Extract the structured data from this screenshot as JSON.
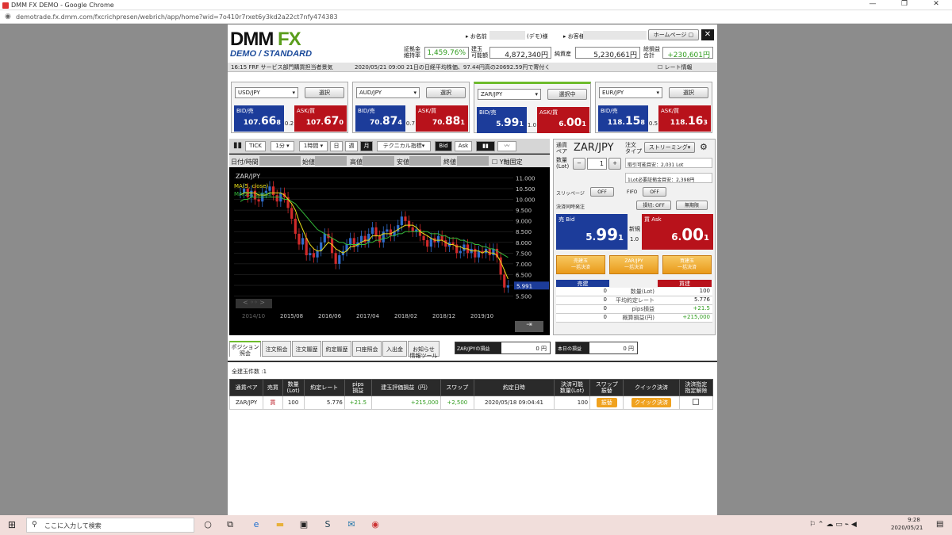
{
  "window": {
    "title": "DMM FX DEMO - Google Chrome",
    "url": "demotrade.fx.dmm.com/fxcrichpresen/webrich/app/home?wid=7o410r7rxet6y3kd2a22ct7nfy474383"
  },
  "brand": {
    "logo_main": "DMM",
    "logo_fx": "FX",
    "logo_sub": "DEMO / STANDARD"
  },
  "header": {
    "name_label": "お名前",
    "name_suffix": "(デモ)様",
    "customer_label": "お客様番号",
    "homepage_button": "ホームページ",
    "close_glyph": "✕",
    "margin_rate_label": "証拠金\n維持率",
    "margin_rate": "1,459.76%",
    "position_capacity_label": "建玉\n可能額",
    "position_capacity": "4,872,340円",
    "net_assets_label": "純資産",
    "net_assets": "5,230,661円",
    "total_pl_label": "総損益\n合計",
    "total_pl": "+230,601円"
  },
  "ticker": {
    "news1": "16:15  FRF サービス部門購買担当者景気",
    "news2": "2020/05/21 09:00 21日の日経平均株価、97.44円高の20692.59円で寄付く",
    "rate_info": "レート情報"
  },
  "quotes": [
    {
      "pair": "USD/JPY",
      "button": "選択",
      "bid_label": "BID/売",
      "ask_label": "ASK/買",
      "bid_small": "107.",
      "bid_big": "66",
      "bid_pip": "8",
      "ask_small": "107.",
      "ask_big": "67",
      "ask_pip": "0",
      "spread": "0.2"
    },
    {
      "pair": "AUD/JPY",
      "button": "選択",
      "bid_label": "BID/売",
      "ask_label": "ASK/買",
      "bid_small": "70.",
      "bid_big": "87",
      "bid_pip": "4",
      "ask_small": "70.",
      "ask_big": "88",
      "ask_pip": "1",
      "spread": "0.7"
    },
    {
      "pair": "ZAR/JPY",
      "button": "選択中",
      "bid_label": "BID/売",
      "ask_label": "ASK/買",
      "bid_small": "5.",
      "bid_big": "99",
      "bid_pip": "1",
      "ask_small": "6.",
      "ask_big": "00",
      "ask_pip": "1",
      "spread": "1.0"
    },
    {
      "pair": "EUR/JPY",
      "button": "選択",
      "bid_label": "BID/売",
      "ask_label": "ASK/買",
      "bid_small": "118.",
      "bid_big": "15",
      "bid_pip": "8",
      "ask_small": "118.",
      "ask_big": "16",
      "ask_pip": "3",
      "spread": "0.5"
    }
  ],
  "chart_toolbar": {
    "tick": "TICK",
    "min1": "1分",
    "hour1": "1時間",
    "day": "日",
    "week": "週",
    "month": "月",
    "tech": "テクニカル指標",
    "bid": "Bid",
    "ask": "Ask"
  },
  "chart_fields": {
    "datetime": "日付/時間",
    "open": "始値",
    "high": "高値",
    "low": "安値",
    "close": "終値",
    "y_fixed": "Y軸固定"
  },
  "chart_data": {
    "type": "candlestick",
    "title": "ZAR/JPY",
    "legend": [
      "MA(5, close)",
      "MA(25, close)"
    ],
    "x_ticks": [
      "2014/10",
      "2015/08",
      "2016/06",
      "2017/04",
      "2018/02",
      "2018/12",
      "2019/10"
    ],
    "y_ticks": [
      11.0,
      10.5,
      10.0,
      9.5,
      9.0,
      8.5,
      8.0,
      7.5,
      7.0,
      6.5,
      6.0,
      5.5
    ],
    "ylim": [
      5.3,
      11.2
    ],
    "current_price": "5.991",
    "close": [
      10.3,
      10.5,
      10.1,
      10.4,
      10.0,
      9.9,
      10.3,
      10.4,
      10.6,
      10.2,
      9.9,
      10.3,
      10.1,
      9.6,
      9.1,
      8.4,
      7.9,
      8.2,
      7.4,
      7.5,
      7.3,
      7.6,
      8.0,
      8.4,
      8.2,
      7.5,
      7.0,
      7.4,
      7.6,
      7.9,
      8.2,
      7.8,
      8.0,
      8.3,
      8.0,
      8.4,
      8.7,
      8.3,
      8.0,
      8.5,
      8.6,
      8.3,
      8.5,
      8.8,
      9.2,
      9.0,
      8.7,
      8.5,
      8.6,
      8.3,
      8.1,
      7.8,
      8.2,
      8.0,
      8.3,
      8.1,
      7.8,
      8.0,
      7.9,
      7.5,
      7.6,
      7.9,
      7.5,
      7.7,
      7.3,
      7.6,
      7.5,
      7.7,
      7.4,
      7.7,
      7.3,
      6.5,
      5.9,
      6.0
    ],
    "ma5": [
      10.2,
      10.3,
      10.3,
      10.3,
      10.3,
      10.2,
      10.2,
      10.2,
      10.3,
      10.3,
      10.3,
      10.3,
      10.2,
      10.0,
      9.8,
      9.5,
      9.0,
      8.6,
      8.2,
      7.9,
      7.7,
      7.6,
      7.6,
      7.8,
      8.0,
      7.9,
      7.7,
      7.6,
      7.5,
      7.6,
      7.8,
      7.8,
      7.9,
      8.0,
      8.1,
      8.1,
      8.3,
      8.3,
      8.3,
      8.4,
      8.4,
      8.4,
      8.5,
      8.6,
      8.7,
      8.8,
      8.8,
      8.8,
      8.7,
      8.5,
      8.4,
      8.3,
      8.2,
      8.1,
      8.1,
      8.1,
      8.0,
      7.9,
      7.9,
      7.8,
      7.8,
      7.7,
      7.7,
      7.6,
      7.6,
      7.6,
      7.5,
      7.6,
      7.5,
      7.5,
      7.4,
      7.1,
      6.7,
      6.3
    ],
    "ma25": [
      9.9,
      10.0,
      10.0,
      10.1,
      10.1,
      10.1,
      10.1,
      10.1,
      10.1,
      10.1,
      10.1,
      10.1,
      10.0,
      10.0,
      9.9,
      9.8,
      9.6,
      9.4,
      9.2,
      9.0,
      8.8,
      8.6,
      8.5,
      8.4,
      8.3,
      8.2,
      8.1,
      8.0,
      8.0,
      7.9,
      7.9,
      7.9,
      7.9,
      7.9,
      7.9,
      8.0,
      8.0,
      8.1,
      8.1,
      8.2,
      8.2,
      8.3,
      8.3,
      8.4,
      8.4,
      8.5,
      8.5,
      8.5,
      8.5,
      8.5,
      8.5,
      8.5,
      8.4,
      8.4,
      8.4,
      8.3,
      8.3,
      8.2,
      8.2,
      8.2,
      8.1,
      8.1,
      8.0,
      8.0,
      7.9,
      7.9,
      7.8,
      7.8,
      7.7,
      7.7,
      7.6,
      7.5,
      7.4,
      7.3
    ]
  },
  "order": {
    "pair_label": "通貨\nペア",
    "pair": "ZAR/JPY",
    "type_label": "注文\nタイプ",
    "type": "ストリーミング",
    "qty_label": "数量\n(Lot)",
    "qty": "1",
    "minus": "−",
    "plus": "+",
    "max_lot": "取引可能目安：2,031 Lot",
    "margin_req": "1Lot必要証拠金目安：2,398円",
    "slippage_label": "スリッページ",
    "slippage": "OFF",
    "fifo_label": "FIFO",
    "fifo": "OFF",
    "settle_label": "決済同時発注",
    "stoploss": "損切: OFF",
    "unlimited": "無期限",
    "bid_label": "売 Bid",
    "bid_small": "5.",
    "bid_big": "99",
    "bid_pip": "1",
    "new_label": "新規",
    "spread": "1.0",
    "ask_label": "買 Ask",
    "ask_small": "6.",
    "ask_big": "00",
    "ask_pip": "1",
    "sell_all": "売建玉\n一括決済",
    "pair_all": "ZAR/JPY\n一括決済",
    "buy_all": "買建玉\n一括決済",
    "sell_head": "売建",
    "buy_head": "買建",
    "rows": [
      {
        "s": "0",
        "k": "数量(Lot)",
        "b": "100"
      },
      {
        "s": "0",
        "k": "平均約定レート",
        "b": "5.776"
      },
      {
        "s": "0",
        "k": "pips損益",
        "b": "+21.5"
      },
      {
        "s": "0",
        "k": "概算損益(円)",
        "b": "+215,000"
      }
    ]
  },
  "tabs": [
    "ポジション\n照会",
    "注文照会",
    "注文履歴",
    "約定履歴",
    "口座照会",
    "入出金",
    "お知らせ\n情報ツール"
  ],
  "pl_boxes": {
    "pair_pl_label": "ZAR/JPYの損益",
    "pair_pl": "0 円",
    "today_pl_label": "本日の損益",
    "today_pl": "0 円"
  },
  "positions": {
    "count_label": "全建玉件数 :1",
    "headers": [
      "通貨ペア",
      "売買",
      "数量\n(Lot)",
      "約定レート",
      "pips\n損益",
      "建玉評価損益（円）",
      "スワップ",
      "約定日時",
      "決済可能\n数量(Lot)",
      "スワップ\n振替",
      "クイック決済",
      "決済指定\n指定解除"
    ],
    "row": {
      "pair": "ZAR/JPY",
      "side": "買",
      "qty": "100",
      "rate": "5.776",
      "pips": "+21.5",
      "pl": "+215,000",
      "swap": "+2,500",
      "datetime": "2020/05/18 09:04:41",
      "closable": "100",
      "swap_btn": "振替",
      "quick_btn": "クイック決済"
    }
  },
  "taskbar": {
    "search": "ここに入力して検索",
    "time": "9:28",
    "date": "2020/05/21"
  },
  "colors": {
    "bid": "#1c3c9a",
    "ask": "#b8121b",
    "accent": "#6dbb2c",
    "candle_up": "#2f6dcc",
    "candle_down": "#d12a2a",
    "ma5": "#e8e01a",
    "ma25": "#34b93a"
  }
}
